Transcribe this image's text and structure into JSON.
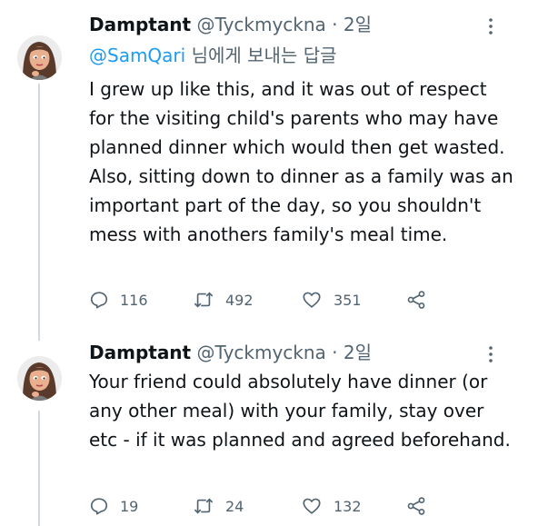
{
  "tweets": [
    {
      "name": "Damptant",
      "handle": "@Tyckmyckna",
      "separator": "·",
      "time": "2일",
      "replying_to": "@SamQari",
      "replying_suffix": "님에게 보내는 답글",
      "text": "I grew up like this, and it was out of respect for the visiting child's parents who may have planned dinner which would then get wasted. Also, sitting down to dinner as a family was an important part of the day, so you shouldn't mess with anothers family's meal time.",
      "replies": "116",
      "retweets": "492",
      "likes": "351"
    },
    {
      "name": "Damptant",
      "handle": "@Tyckmyckna",
      "separator": "·",
      "time": "2일",
      "text": "Your friend could absolutely have dinner (or any other meal) with your family, stay over etc - if it was planned and agreed beforehand.",
      "replies": "19",
      "retweets": "24",
      "likes": "132"
    }
  ],
  "icons": {
    "reply": "reply-icon",
    "retweet": "retweet-icon",
    "like": "heart-icon",
    "share": "share-icon",
    "more": "more-icon"
  },
  "colors": {
    "accent": "#1d9bf0",
    "muted": "#536471",
    "text": "#0f1419",
    "thread_line": "#cfd9de"
  }
}
